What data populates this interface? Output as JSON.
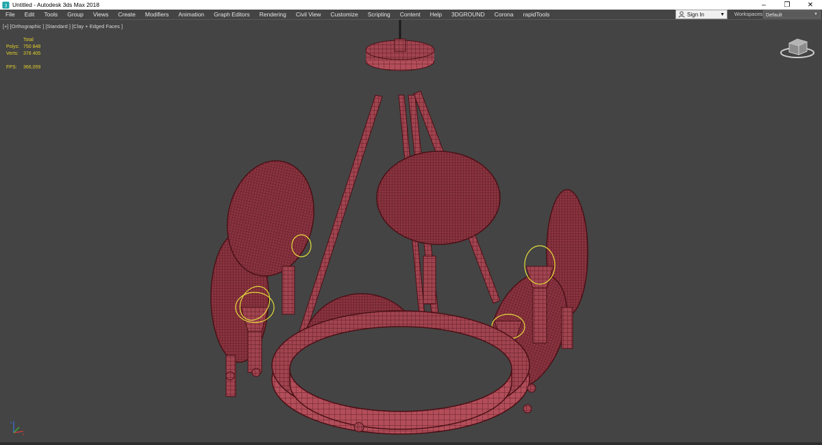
{
  "window": {
    "title": "Untitled - Autodesk 3ds Max 2018",
    "controls": [
      "–",
      "❐",
      "✕"
    ]
  },
  "menu": {
    "items": [
      "File",
      "Edit",
      "Tools",
      "Group",
      "Views",
      "Create",
      "Modifiers",
      "Animation",
      "Graph Editors",
      "Rendering",
      "Civil View",
      "Customize",
      "Scripting",
      "Content",
      "Help",
      "3DGROUND",
      "Corona",
      "rapidTools"
    ]
  },
  "account": {
    "sign_in_label": "Sign In"
  },
  "workspaces": {
    "label": "Workspaces:",
    "selected": "Default"
  },
  "viewport": {
    "label": "[+] [Orthographic ] [Standard ] [Clay + Edged Faces ]",
    "stats": {
      "total_label": "Total",
      "polys_label": "Polys:",
      "polys_value": "750 848",
      "verts_label": "Verts:",
      "verts_value": "376 405",
      "fps_label": "FPS:",
      "fps_value": "366,059"
    }
  },
  "colors": {
    "mesh_fill": "#a04450",
    "mesh_wire": "#4a1016",
    "bulb_highlight": "#e6e03a",
    "viewport_bg": "#444444",
    "stats_text": "#e3cf2a"
  },
  "icons": {
    "app": "3dsmax-app-icon",
    "user": "user-icon",
    "viewcube": "viewcube-icon",
    "axis": "axis-tripod-icon"
  }
}
